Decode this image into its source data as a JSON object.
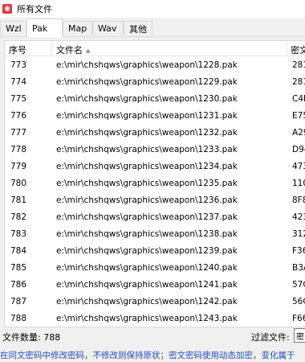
{
  "window": {
    "title": "所有文件",
    "icon_name": "app-icon"
  },
  "tabs": [
    {
      "label": "Wzl",
      "active": false
    },
    {
      "label": "Pak",
      "active": true
    },
    {
      "label": "Map",
      "active": false
    },
    {
      "label": "Wav",
      "active": false
    },
    {
      "label": "其他",
      "active": false
    }
  ],
  "table": {
    "columns": [
      "序号",
      "文件名",
      "密文"
    ],
    "sort_column": "文件名",
    "sort_direction": "ascending",
    "rows": [
      {
        "index": "773",
        "filename": "e:\\mir\\chshqws\\graphics\\weapon\\1228.pak",
        "cipher": "281"
      },
      {
        "index": "774",
        "filename": "e:\\mir\\chshqws\\graphics\\weapon\\1229.pak",
        "cipher": "281"
      },
      {
        "index": "775",
        "filename": "e:\\mir\\chshqws\\graphics\\weapon\\1230.pak",
        "cipher": "C4B"
      },
      {
        "index": "776",
        "filename": "e:\\mir\\chshqws\\graphics\\weapon\\1231.pak",
        "cipher": "E75"
      },
      {
        "index": "777",
        "filename": "e:\\mir\\chshqws\\graphics\\weapon\\1232.pak",
        "cipher": "A29"
      },
      {
        "index": "778",
        "filename": "e:\\mir\\chshqws\\graphics\\weapon\\1233.pak",
        "cipher": "D94"
      },
      {
        "index": "779",
        "filename": "e:\\mir\\chshqws\\graphics\\weapon\\1234.pak",
        "cipher": "473"
      },
      {
        "index": "780",
        "filename": "e:\\mir\\chshqws\\graphics\\weapon\\1235.pak",
        "cipher": "110"
      },
      {
        "index": "781",
        "filename": "e:\\mir\\chshqws\\graphics\\weapon\\1236.pak",
        "cipher": "8F8"
      },
      {
        "index": "782",
        "filename": "e:\\mir\\chshqws\\graphics\\weapon\\1237.pak",
        "cipher": "423"
      },
      {
        "index": "783",
        "filename": "e:\\mir\\chshqws\\graphics\\weapon\\1238.pak",
        "cipher": "312"
      },
      {
        "index": "784",
        "filename": "e:\\mir\\chshqws\\graphics\\weapon\\1239.pak",
        "cipher": "F36"
      },
      {
        "index": "785",
        "filename": "e:\\mir\\chshqws\\graphics\\weapon\\1240.pak",
        "cipher": "B3A"
      },
      {
        "index": "786",
        "filename": "e:\\mir\\chshqws\\graphics\\weapon\\1241.pak",
        "cipher": "57C"
      },
      {
        "index": "787",
        "filename": "e:\\mir\\chshqws\\graphics\\weapon\\1242.pak",
        "cipher": "56C"
      },
      {
        "index": "788",
        "filename": "e:\\mir\\chshqws\\graphics\\weapon\\1243.pak",
        "cipher": "F66"
      }
    ]
  },
  "status": {
    "file_count_label": "文件数量: 788",
    "filter_label": "过滤文件:",
    "filter_value": "密"
  },
  "hint": "在同文密码中修改密码，不修改则保持原状；密文密码使用动态加密，变化属于"
}
